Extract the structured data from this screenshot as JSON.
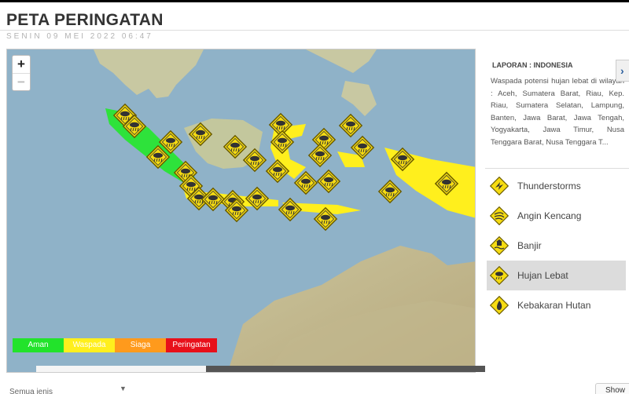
{
  "header": {
    "title": "PETA PERINGATAN",
    "datetime": "SENIN 09 MEI 2022 06:47"
  },
  "map": {
    "zoom_in": "+",
    "zoom_out": "−",
    "legend": [
      {
        "label": "Aman",
        "color": "#22e32b"
      },
      {
        "label": "Waspada",
        "color": "#ffef1d"
      },
      {
        "label": "Siaga",
        "color": "#ff9a1c"
      },
      {
        "label": "Peringatan",
        "color": "#e8101a"
      }
    ]
  },
  "panel": {
    "report_title": "LAPORAN : INDONESIA",
    "report_text": "Waspada potensi hujan lebat di wilayah : Aceh, Sumatera Barat, Riau, Kep. Riau, Sumatera Selatan, Lampung, Banten, Jawa Barat, Jawa Tengah, Yogyakarta, Jawa Timur, Nusa Tenggara Barat, Nusa Tenggara T...",
    "next_arrow": "›",
    "categories": [
      {
        "label": "Thunderstorms",
        "icon": "lightning-icon",
        "active": false
      },
      {
        "label": "Angin Kencang",
        "icon": "wind-icon",
        "active": false
      },
      {
        "label": "Banjir",
        "icon": "flood-icon",
        "active": false
      },
      {
        "label": "Hujan Lebat",
        "icon": "heavy-rain-icon",
        "active": true
      },
      {
        "label": "Kebakaran Hutan",
        "icon": "fire-icon",
        "active": false
      }
    ]
  },
  "footer": {
    "select_label": "Semua jenis",
    "show_button": "Show"
  },
  "colors": {
    "sea": "#90b4c9",
    "land": "#d9d9b8",
    "warning_icon": "#f6dc12"
  }
}
